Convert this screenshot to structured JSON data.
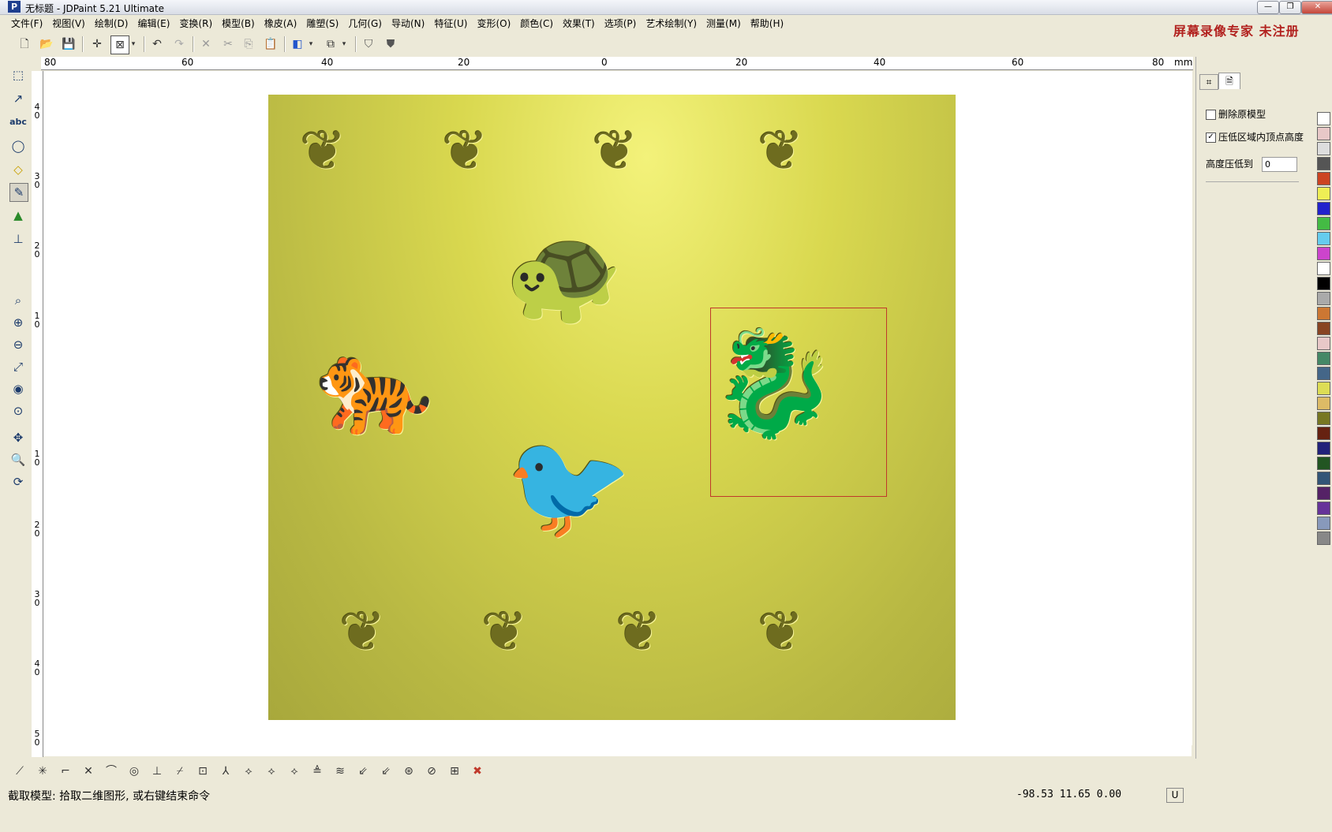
{
  "window": {
    "title": "无标题 - JDPaint 5.21 Ultimate",
    "logo": "P"
  },
  "title_buttons": {
    "minimize": "—",
    "restore": "❐",
    "close": "✕"
  },
  "menu": [
    "文件(F)",
    "视图(V)",
    "绘制(D)",
    "编辑(E)",
    "变换(R)",
    "模型(B)",
    "橡皮(A)",
    "雕塑(S)",
    "几何(G)",
    "导动(N)",
    "特征(U)",
    "变形(O)",
    "颜色(C)",
    "效果(T)",
    "选项(P)",
    "艺术绘制(Y)",
    "测量(M)",
    "帮助(H)"
  ],
  "watermark": "屏幕录像专家  未注册",
  "ruler": {
    "labels": [
      "80",
      "60",
      "40",
      "20",
      "0",
      "20",
      "40",
      "60",
      "80"
    ],
    "unit": "mm"
  },
  "vruler": [
    "4 0",
    "3 0",
    "2 0",
    "1 0",
    "1 0",
    "2 0",
    "3 0",
    "4 0",
    "5 0"
  ],
  "toolbar_icons": [
    "new-file-icon",
    "open-file-icon",
    "save-icon",
    "crosshair-icon",
    "select-box-icon",
    "dropdown-icon",
    "undo-icon",
    "redo-icon",
    "delete-icon",
    "cut-icon",
    "copy-icon",
    "paste-icon",
    "view-3d-icon",
    "dropdown-icon",
    "view-iso-icon",
    "dropdown-icon",
    "shield-icon",
    "shield-filled-icon"
  ],
  "left_tools": [
    "select-icon",
    "curve-icon",
    "text-abc-icon",
    "shape-icon",
    "eraser-icon",
    "pen-icon",
    "tree-icon",
    "measure-icon",
    "zoom-window-icon",
    "zoom-in-icon",
    "zoom-out-icon",
    "zoom-fit-icon",
    "eye-icon",
    "zoom-all-icon",
    "pan-icon",
    "zoom-icon",
    "rotate-icon"
  ],
  "panel": {
    "delete_original_label": "删除原模型",
    "delete_original_checked": false,
    "lower_vertices_label": "压低区域内顶点高度",
    "lower_vertices_checked": true,
    "height_label": "高度压低到",
    "height_value": "0"
  },
  "palette": [
    "#ffffff",
    "#e8c8c8",
    "#dddddd",
    "#555555",
    "#cc4422",
    "#eeee55",
    "#2222cc",
    "#44bb44",
    "#66ccee",
    "#cc44cc",
    "#ffffff",
    "#000000",
    "#aaaaaa",
    "#cc7733",
    "#884422",
    "#e8c8c8",
    "#448866",
    "#446688",
    "#dddd55",
    "#ddbb66",
    "#777722",
    "#662211",
    "#22227a",
    "#225522",
    "#335577",
    "#552266",
    "#663399",
    "#8899bb",
    "#888888"
  ],
  "bottom_tools": [
    "line-icon",
    "curve-snap-icon",
    "corner-icon",
    "intersect-icon",
    "arc-icon",
    "circle-snap-icon",
    "perpendicular-icon",
    "tangent-icon",
    "grid-snap-icon",
    "angle-snap-icon",
    "node-a-icon",
    "node-b-icon",
    "node-c-icon",
    "level-a-icon",
    "level-b-icon",
    "pick-a-icon",
    "pick-b-icon",
    "trim-a-icon",
    "trim-b-icon",
    "trim-c-icon",
    "cancel-icon"
  ],
  "status": {
    "message": "截取模型: 拾取二维图形, 或右键结束命令",
    "coords": "-98.53 11.65 0.00",
    "mode": "U"
  }
}
